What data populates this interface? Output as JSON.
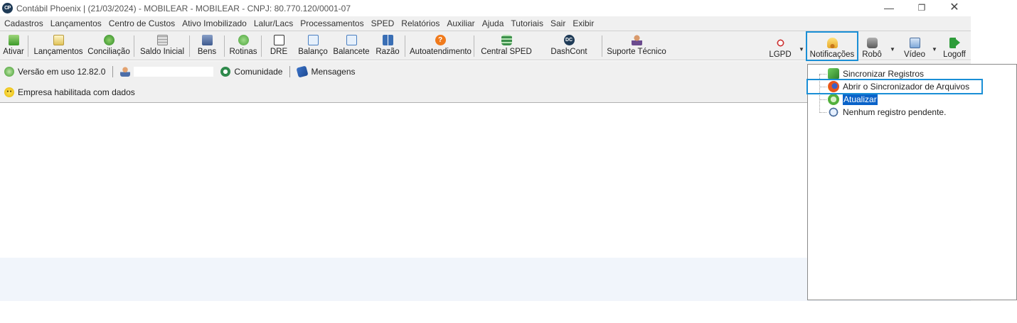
{
  "window": {
    "logo_text": "CP",
    "title": "Contábil Phoenix | (21/03/2024) - MOBILEAR - MOBILEAR  - CNPJ: 80.770.120/0001-07",
    "minimize": "—",
    "maximize": "❐",
    "close": "✕"
  },
  "menu": [
    "Cadastros",
    "Lançamentos",
    "Centro de Custos",
    "Ativo Imobilizado",
    "Lalur/Lacs",
    "Processamentos",
    "SPED",
    "Relatórios",
    "Auxiliar",
    "Ajuda",
    "Tutoriais",
    "Sair",
    "Exibir"
  ],
  "toolbar": {
    "ativar": "Ativar",
    "lancamentos": "Lançamentos",
    "conciliacao": "Conciliação",
    "saldo_inicial": "Saldo Inicial",
    "bens": "Bens",
    "rotinas": "Rotinas",
    "dre": "DRE",
    "balanco": "Balanço",
    "balancete": "Balancete",
    "razao": "Razão",
    "autoatendimento": "Autoatendimento",
    "autoatendimento_icon": "?",
    "central_sped": "Central SPED",
    "dashcont": "DashCont",
    "dashcont_icon": "DC",
    "suporte_tecnico": "Suporte Técnico",
    "lgpd": "LGPD",
    "notificacoes": "Notificações",
    "robo": "Robô",
    "video": "Vídeo",
    "logoff": "Logoff",
    "dropdown_arrow": "▼"
  },
  "info_bar": {
    "version": "Versão em uso 12.82.0",
    "user_value": "",
    "community": "Comunidade",
    "messages": "Mensagens"
  },
  "status": {
    "company": "Empresa habilitada com dados"
  },
  "notifications_panel": {
    "items": [
      "Sincronizar Registros",
      "Abrir o Sincronizador de Arquivos",
      "Atualizar",
      "Nenhum registro pendente."
    ],
    "selected_index": 2
  },
  "colors": {
    "highlight_border": "#1a8fd6",
    "selection": "#0a63c9"
  }
}
